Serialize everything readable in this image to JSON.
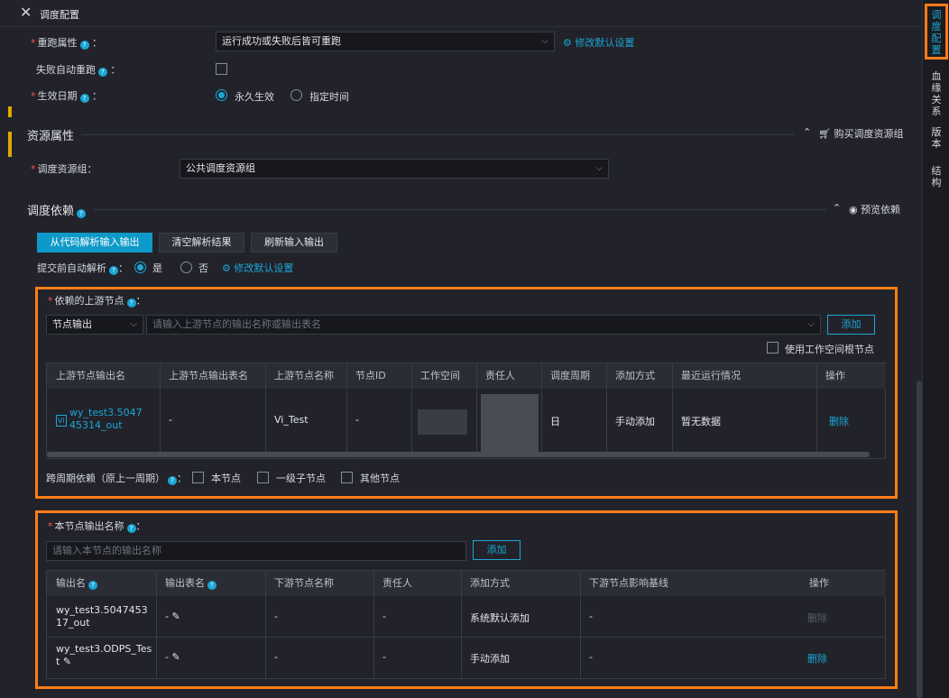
{
  "header": {
    "title": "调度配置"
  },
  "rerun": {
    "label": "重跑属性",
    "colon": "：",
    "value": "运行成功或失败后皆可重跑",
    "link": "修改默认设置"
  },
  "auto_rerun": {
    "label": "失败自动重跑",
    "colon": "："
  },
  "effective_date": {
    "label": "生效日期",
    "colon": "：",
    "opt1": "永久生效",
    "opt2": "指定时间"
  },
  "resource": {
    "section": "资源属性",
    "buy": "购买调度资源组",
    "label": "调度资源组",
    "colon": "：",
    "value": "公共调度资源组"
  },
  "dependency": {
    "section": "调度依赖",
    "preview": "预览依赖",
    "btn_parse": "从代码解析输入输出",
    "btn_clear": "清空解析结果",
    "btn_refresh": "刷新输入输出",
    "auto_parse_label": "提交前自动解析",
    "colon": "：",
    "yes": "是",
    "no": "否",
    "link": "修改默认设置"
  },
  "upstream": {
    "label": "依赖的上游节点",
    "colon": "：",
    "type": "节点输出",
    "placeholder": "请输入上游节点的输出名称或输出表名",
    "add": "添加",
    "workspace_root": "使用工作空间根节点",
    "columns": [
      "上游节点输出名",
      "上游节点输出表名",
      "上游节点名称",
      "节点ID",
      "工作空间",
      "责任人",
      "调度周期",
      "添加方式",
      "最近运行情况",
      "操作"
    ],
    "row": {
      "badge": "Vi",
      "output": "wy_test3.504745314_out",
      "table": "-",
      "name": "Vi_Test",
      "id": "-",
      "period": "日",
      "method": "手动添加",
      "status": "暂无数据",
      "op": "删除"
    },
    "cross_label": "跨周期依赖（原上一周期）",
    "opt1": "本节点",
    "opt2": "一级子节点",
    "opt3": "其他节点"
  },
  "outputs": {
    "label": "本节点输出名称",
    "colon": "：",
    "placeholder": "请输入本节点的输出名称",
    "add": "添加",
    "columns": [
      "输出名",
      "输出表名",
      "下游节点名称",
      "责任人",
      "添加方式",
      "下游节点影响基线",
      "操作"
    ],
    "rows": [
      {
        "name": "wy_test3.504745317_out",
        "table": "-",
        "downstream": "-",
        "owner": "-",
        "method": "系统默认添加",
        "baseline": "-",
        "op": "删除"
      },
      {
        "name": "wy_test3.ODPS_Test",
        "table": "-",
        "downstream": "-",
        "owner": "-",
        "method": "手动添加",
        "baseline": "-",
        "op": "删除"
      }
    ]
  },
  "sidebar": {
    "tabs": [
      "调度配置",
      "血缘关系",
      "版本",
      "结构"
    ]
  },
  "colors": {
    "accent": "#1aa6d6",
    "highlight": "#ff7c1a",
    "required": "#ff4d4f"
  }
}
